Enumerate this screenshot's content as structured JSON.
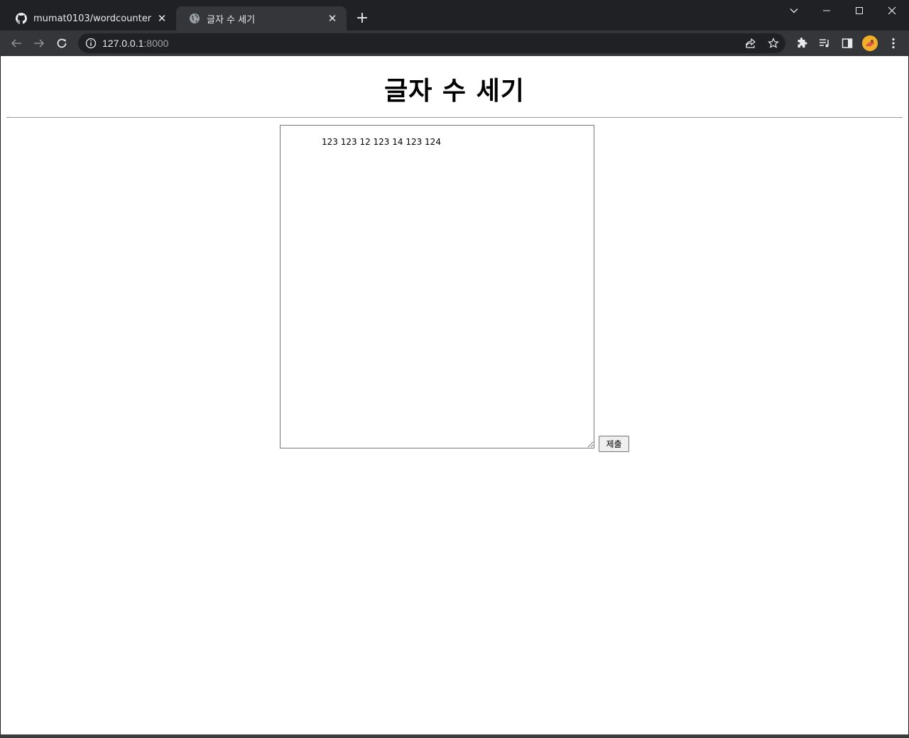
{
  "browser": {
    "tabs": [
      {
        "title": "mumat0103/wordcounter",
        "favicon": "github-icon",
        "active": false
      },
      {
        "title": "글자 수 세기",
        "favicon": "globe-icon",
        "active": true
      }
    ],
    "address": {
      "host": "127.0.0.1",
      "port": ":8000"
    }
  },
  "page": {
    "heading": "글자 수 세기",
    "textarea_value": "123 123 12 123 14 123 124",
    "submit_label": "제출"
  }
}
